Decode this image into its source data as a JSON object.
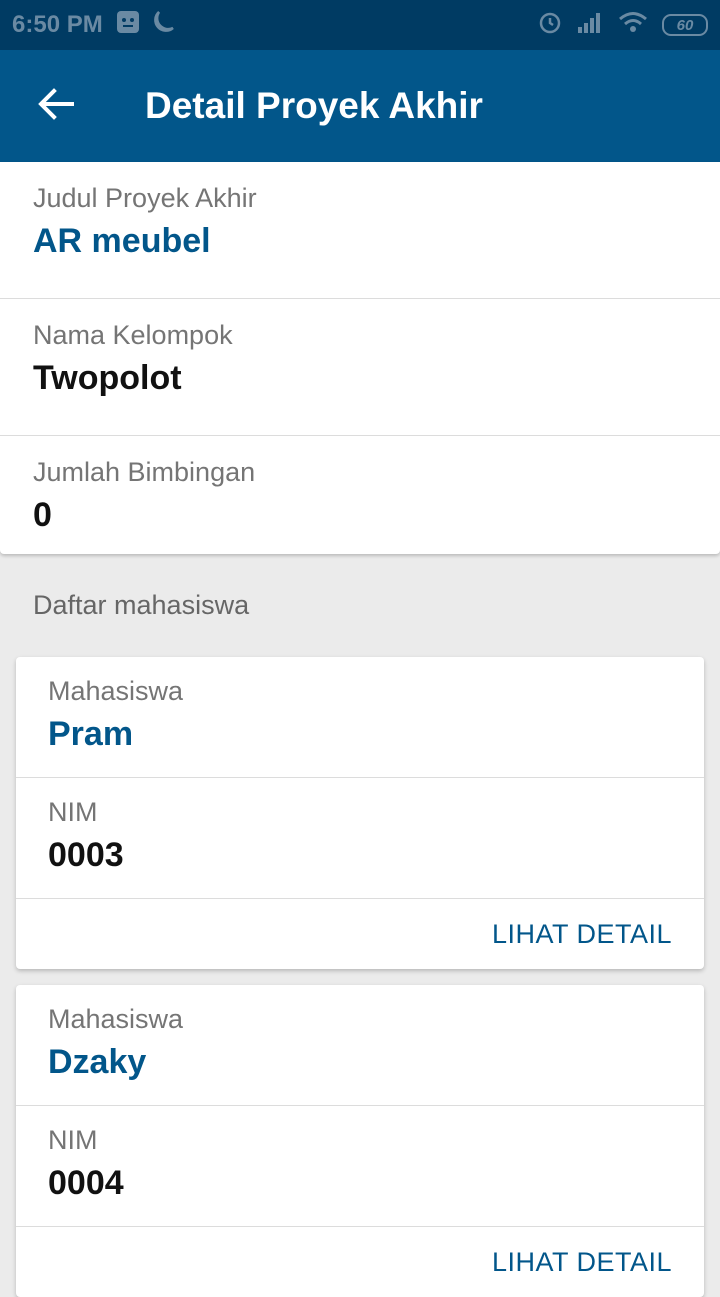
{
  "status_bar": {
    "time": "6:50 PM",
    "battery": "60",
    "icons": [
      "notification-app-icon",
      "moon-icon",
      "alarm-icon",
      "signal-icon",
      "wifi-icon",
      "battery-icon"
    ]
  },
  "app_bar": {
    "title": "Detail Proyek Akhir",
    "back_icon": "arrow-left-icon"
  },
  "project": {
    "title_label": "Judul Proyek Akhir",
    "title_value": "AR meubel",
    "group_label": "Nama Kelompok",
    "group_value": "Twopolot",
    "guidance_label": "Jumlah Bimbingan",
    "guidance_value": "0"
  },
  "students_section": {
    "title": "Daftar mahasiswa",
    "students": [
      {
        "name_label": "Mahasiswa",
        "name": "Pram",
        "nim_label": "NIM",
        "nim": "0003",
        "action": "LIHAT DETAIL"
      },
      {
        "name_label": "Mahasiswa",
        "name": "Dzaky",
        "nim_label": "NIM",
        "nim": "0004",
        "action": "LIHAT DETAIL"
      }
    ]
  },
  "colors": {
    "primary": "#02568a",
    "status_bar": "#003b63",
    "background": "#ebebeb"
  }
}
